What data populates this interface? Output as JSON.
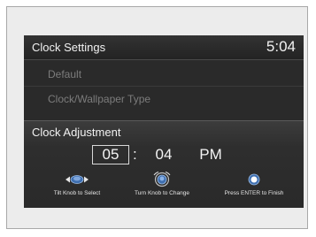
{
  "header": {
    "title": "Clock Settings",
    "clock": "5:04"
  },
  "menu": {
    "items": [
      {
        "label": "Default"
      },
      {
        "label": "Clock/Wallpaper Type"
      }
    ]
  },
  "adjustment": {
    "title": "Clock Adjustment",
    "hours": "05",
    "separator": ":",
    "minutes": "04",
    "period": "PM"
  },
  "hints": [
    {
      "icon": "tilt-knob-icon",
      "label": "Tilt Knob to Select"
    },
    {
      "icon": "turn-knob-icon",
      "label": "Turn Knob to Change"
    },
    {
      "icon": "press-enter-icon",
      "label": "Press ENTER to Finish"
    }
  ]
}
